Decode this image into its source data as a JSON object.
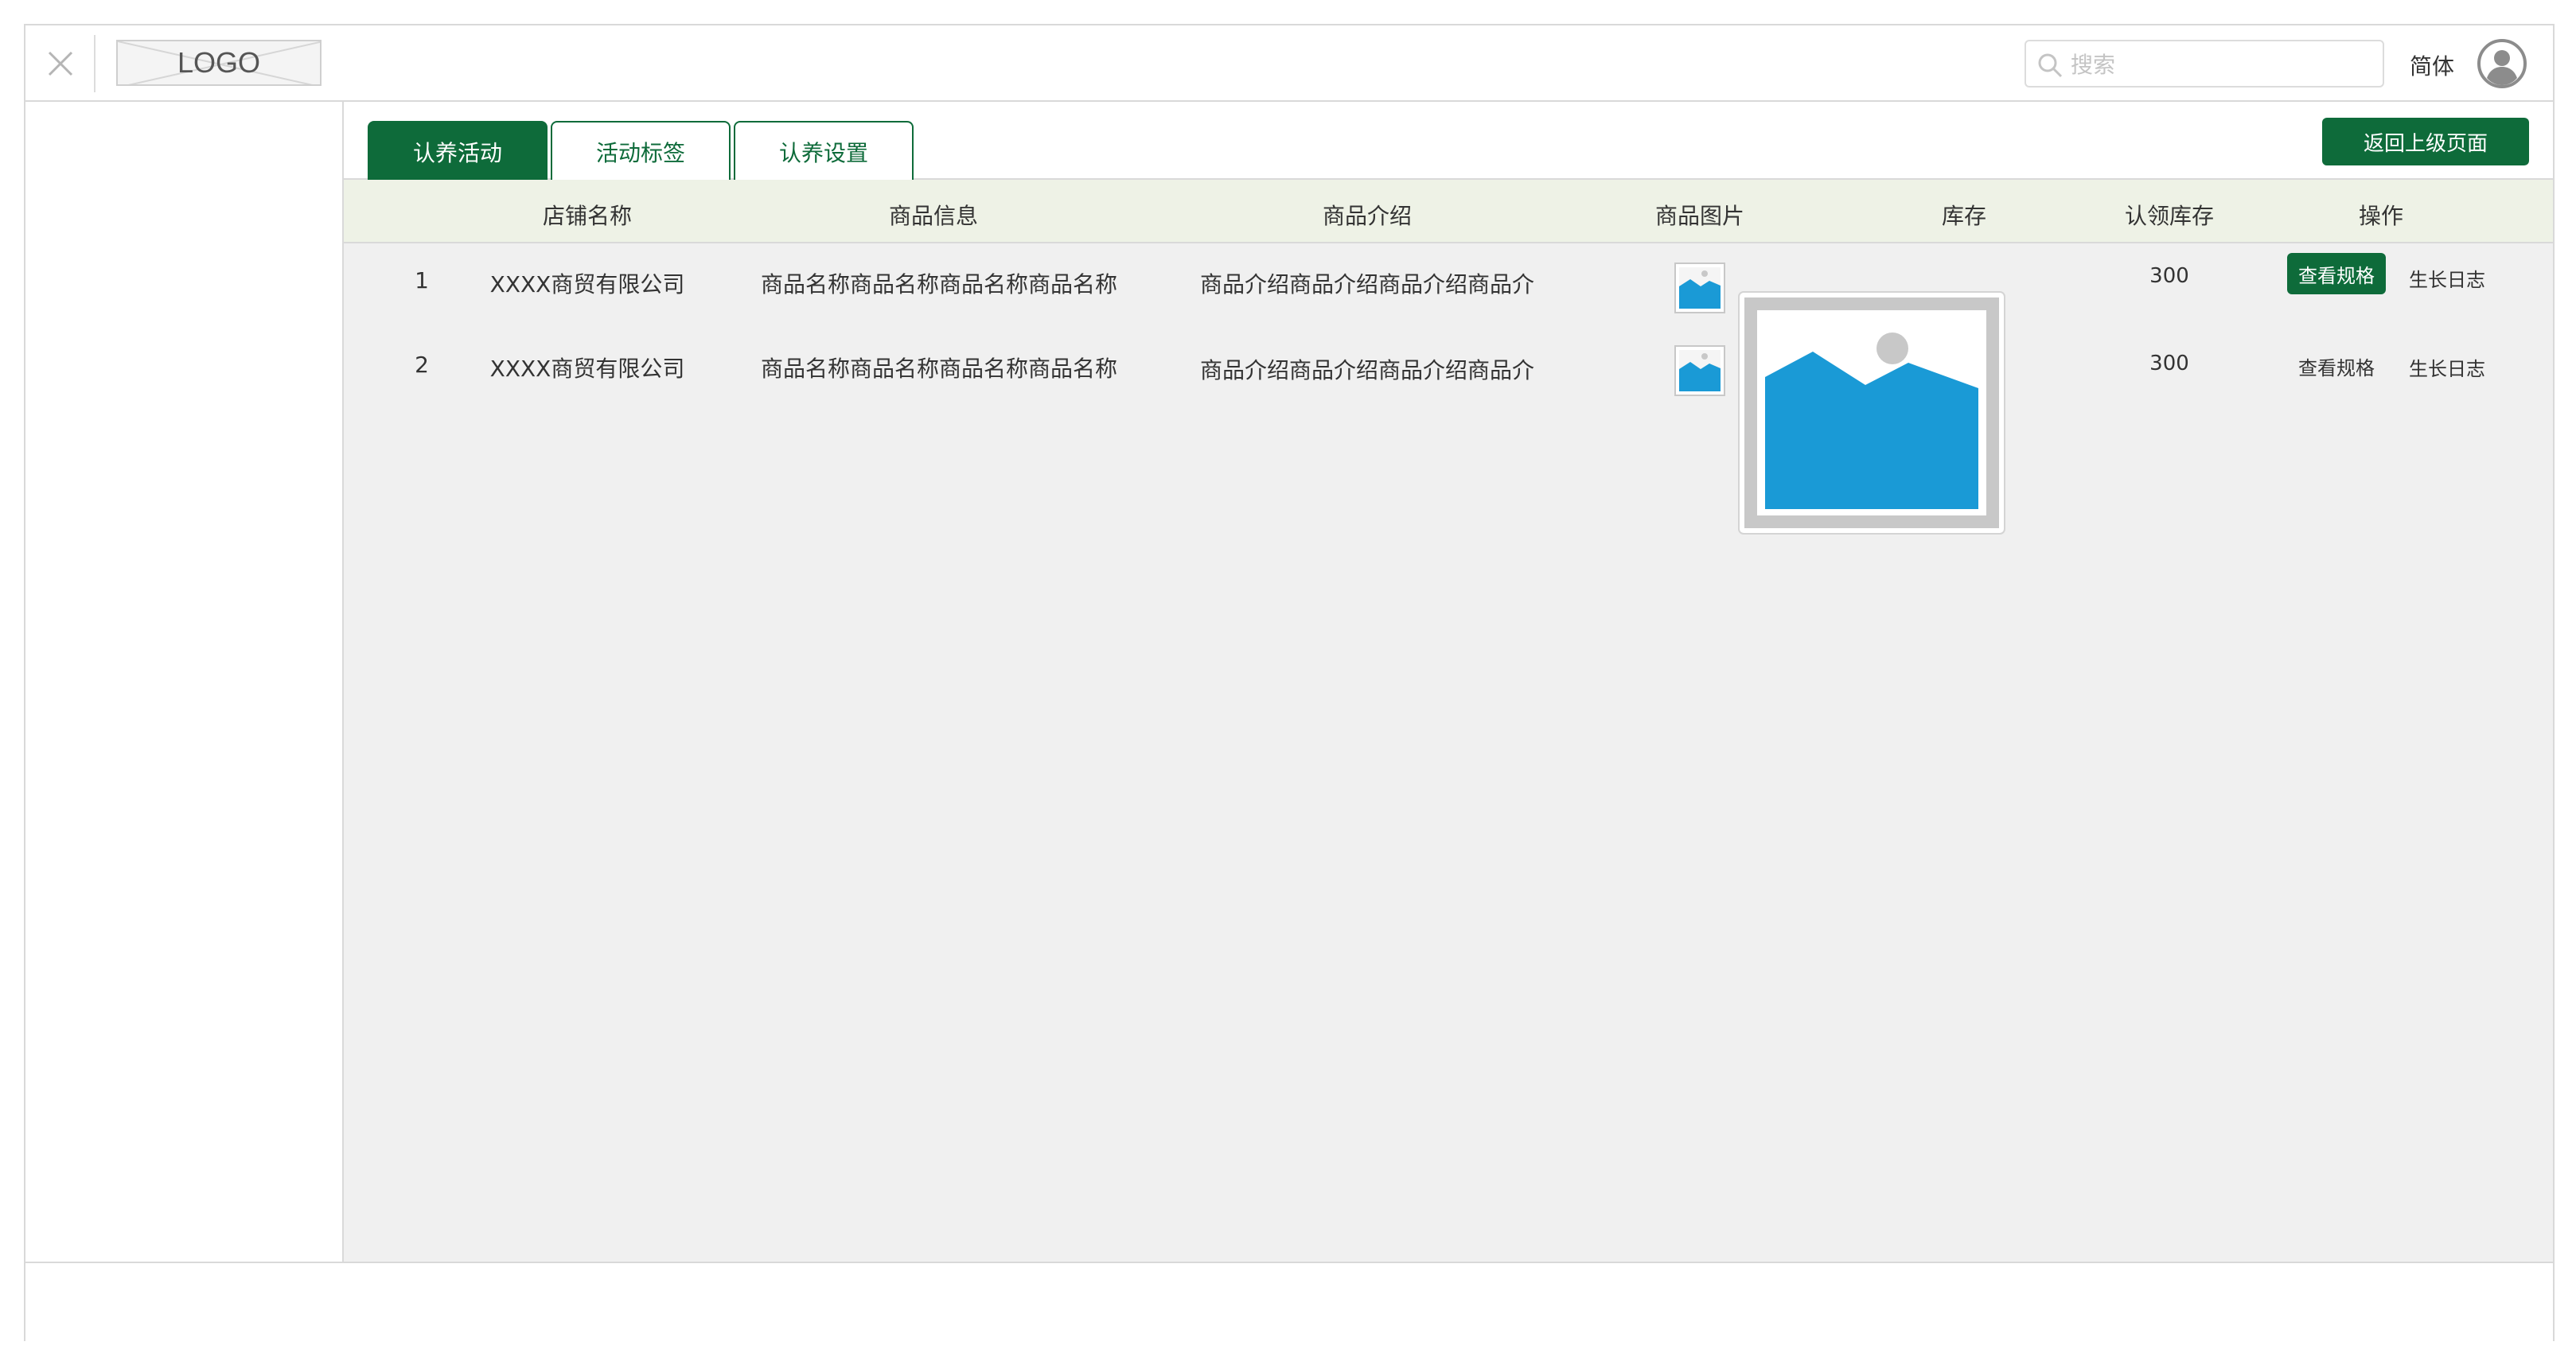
{
  "header": {
    "logo_text": "LOGO",
    "search_placeholder": "搜索",
    "language": "简体"
  },
  "tabs": [
    {
      "label": "认养活动",
      "active": true
    },
    {
      "label": "活动标签",
      "active": false
    },
    {
      "label": "认养设置",
      "active": false
    }
  ],
  "back_button": "返回上级页面",
  "table": {
    "headers": [
      "店铺名称",
      "商品信息",
      "商品介绍",
      "商品图片",
      "库存",
      "认领库存",
      "操作"
    ],
    "rows": [
      {
        "index": "1",
        "shop": "XXXX商贸有限公司",
        "info": "商品名称商品名称商品名称商品名称",
        "intro": "商品介绍商品介绍商品介绍商品介",
        "stock": "",
        "claimed": "300",
        "action_spec": "查看规格",
        "action_log": "生长日志"
      },
      {
        "index": "2",
        "shop": "XXXX商贸有限公司",
        "info": "商品名称商品名称商品名称商品名称",
        "intro": "商品介绍商品介绍商品介绍商品介",
        "stock": "",
        "claimed": "300",
        "action_spec": "查看规格",
        "action_log": "生长日志"
      }
    ]
  },
  "colors": {
    "primary": "#0e6b3a",
    "header_row_bg": "#eef2e6",
    "content_bg": "#f0f0f0",
    "image_blue": "#1a9ad6"
  }
}
